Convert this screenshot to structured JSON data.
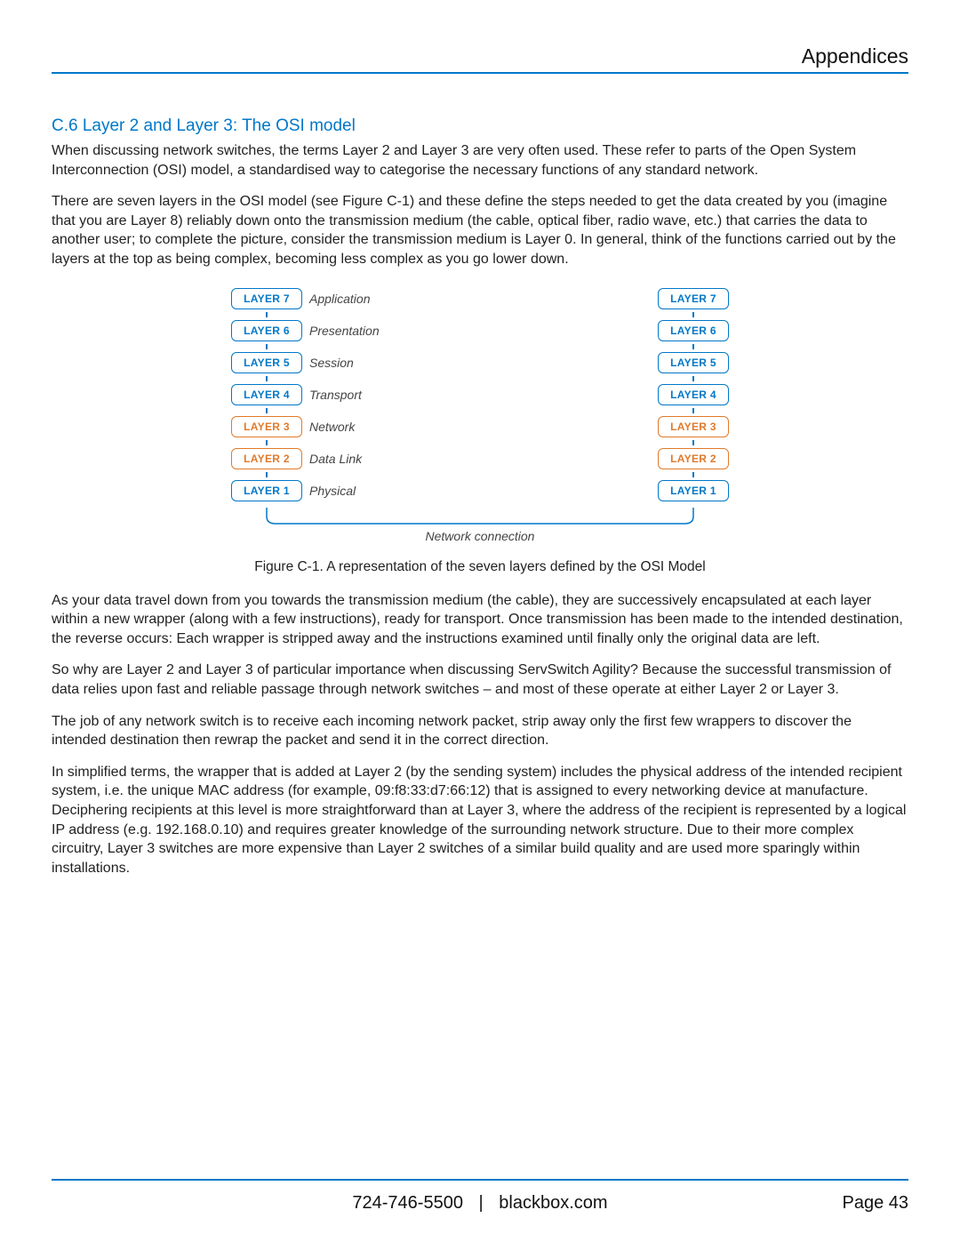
{
  "header": {
    "title": "Appendices"
  },
  "section": {
    "heading": "C.6 Layer 2 and Layer 3: The OSI model",
    "p1": "When discussing network switches, the terms Layer 2 and Layer 3 are very often used. These refer to parts of the Open System Interconnection (OSI) model, a standardised way to categorise the necessary functions of any standard network.",
    "p2": "There are seven layers in the OSI model (see Figure C-1) and these define the steps needed to get the data created by you (imagine that you are Layer 8) reliably down onto the transmission medium (the cable, optical fiber, radio wave, etc.) that carries the data to another user; to complete the picture, consider the transmission medium is Layer 0. In general, think of the functions carried out by the layers at the top as being complex, becoming less complex as you go lower down.",
    "p3": "As your data travel down from you towards the transmission medium (the cable), they are successively encapsulated at each layer within a new wrapper (along with a few instructions), ready for transport. Once transmission has been made to the intended destination, the reverse occurs: Each wrapper is stripped away and the instructions examined until finally only the original data are left.",
    "p4": "So why are Layer 2 and Layer 3 of particular importance when discussing ServSwitch Agility? Because the successful transmission of data relies upon fast and reliable passage through network switches – and most of these operate at either Layer 2 or Layer 3.",
    "p5": "The job of any network switch is to receive each incoming network packet, strip away only the first few wrappers to discover the intended destination then rewrap the packet and send it in the correct direction.",
    "p6": "In simplified terms, the wrapper that is added at Layer 2 (by the sending system) includes the physical address of the intended recipient system, i.e. the unique MAC address (for example, 09:f8:33:d7:66:12) that is assigned to every networking device at manufacture. Deciphering recipients at this level is more straightforward than at Layer 3, where the address of the recipient is represented by a logical IP address (e.g. 192.168.0.10) and requires greater knowledge of the surrounding network structure. Due to their more complex circuitry, Layer 3 switches are more expensive than Layer 2 switches of a similar build quality and are used more sparingly within installations."
  },
  "diagram": {
    "layers": [
      {
        "box": "LAYER 7",
        "label": "Application",
        "highlight": false
      },
      {
        "box": "LAYER 6",
        "label": "Presentation",
        "highlight": false
      },
      {
        "box": "LAYER 5",
        "label": "Session",
        "highlight": false
      },
      {
        "box": "LAYER 4",
        "label": "Transport",
        "highlight": false
      },
      {
        "box": "LAYER 3",
        "label": "Network",
        "highlight": true
      },
      {
        "box": "LAYER 2",
        "label": "Data Link",
        "highlight": true
      },
      {
        "box": "LAYER 1",
        "label": "Physical",
        "highlight": false
      }
    ],
    "connection_label": "Network connection",
    "caption": "Figure C-1. A representation of the seven layers defined by the OSI Model"
  },
  "footer": {
    "phone": "724-746-5500",
    "site": "blackbox.com",
    "page_label": "Page 43"
  }
}
